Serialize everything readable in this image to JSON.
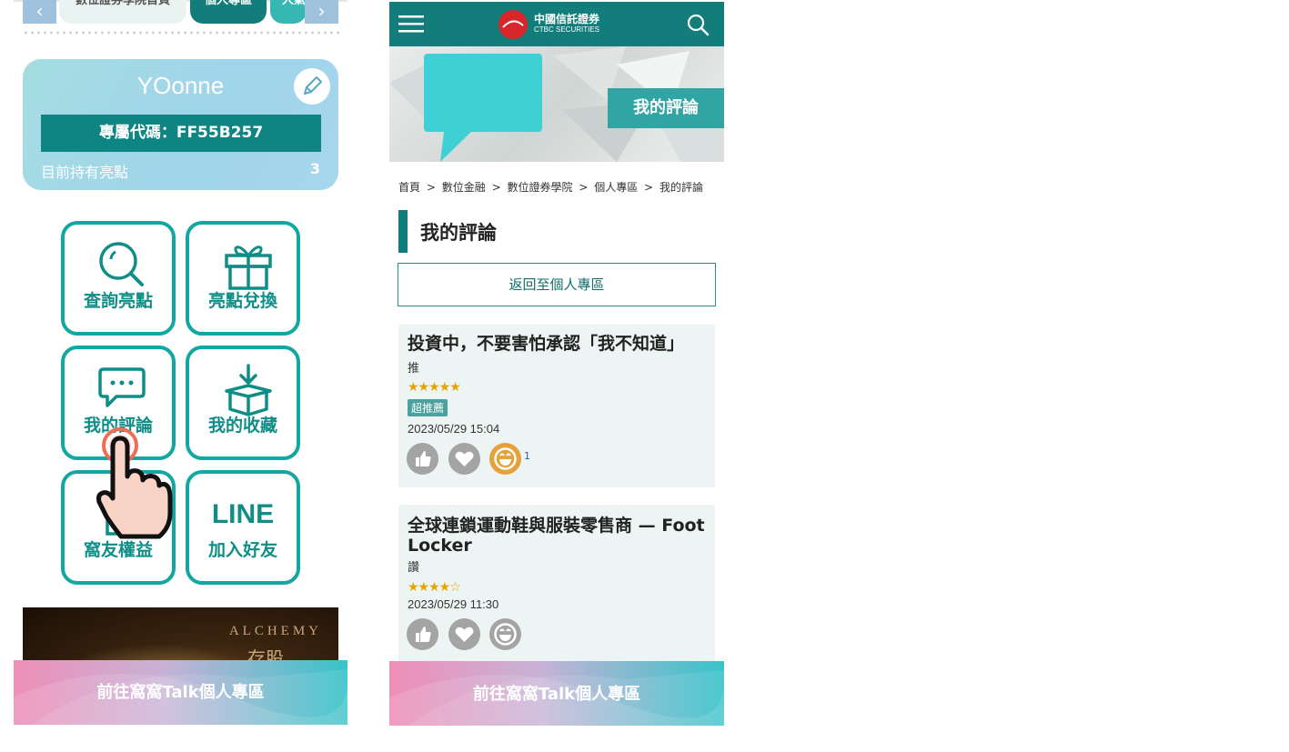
{
  "left_panel": {
    "tabs": [
      "數位證券學院首頁",
      "個人專區",
      "人氣"
    ],
    "prev_arrow": "‹",
    "next_arrow": "›",
    "profile": {
      "name": "YOonne",
      "code_label": "專屬代碼：FF55B257",
      "points_label": "目前持有亮點",
      "points_value": "3"
    },
    "tiles": [
      {
        "label": "查詢亮點",
        "icon": "search-icon"
      },
      {
        "label": "亮點兌換",
        "icon": "gift-icon"
      },
      {
        "label": "我的評論",
        "icon": "comment-icon"
      },
      {
        "label": "我的收藏",
        "icon": "box-icon"
      },
      {
        "label": "窩友權益",
        "icon": "document-icon"
      },
      {
        "label": "加入好友",
        "icon": "line-logo",
        "logo_text": "LINE"
      }
    ],
    "banner_text": "ALCHEMY",
    "banner_text_2": "存股",
    "talk_button": "前往窩窩Talk個人專區"
  },
  "right_panel": {
    "brand": {
      "name": "中國信託證券",
      "subname": "CTBC SECURITIES"
    },
    "hero_tag": "我的評論",
    "breadcrumb": [
      "首頁",
      ">",
      "數位金融",
      ">",
      "數位證券學院",
      ">",
      "個人專區",
      ">",
      "我的評論"
    ],
    "page_title": "我的評論",
    "back_button": "返回至個人專區",
    "reviews": [
      {
        "title": "投資中，不要害怕承認「我不知道」",
        "category": "推",
        "stars": "★★★★★",
        "rating": 5,
        "badge": "超推薦",
        "time": "2023/05/29 15:04",
        "reaction_count": "1"
      },
      {
        "title": "全球連鎖運動鞋與服裝零售商 — Foot Locker",
        "category": "讚",
        "stars": "★★★★☆",
        "rating": 4,
        "time": "2023/05/29 11:30"
      }
    ],
    "talk_button": "前往窩窩Talk個人專區"
  },
  "colors": {
    "teal_dark": "#127d7a",
    "teal": "#12a8a1",
    "card_bg": "#edf4f4",
    "star": "#e6a300",
    "reaction_active": "#e5a23b"
  }
}
